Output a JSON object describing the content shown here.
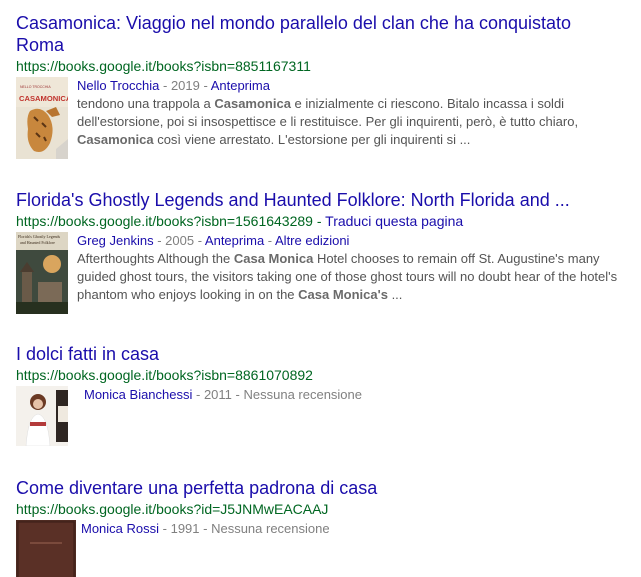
{
  "results": [
    {
      "title_line1": "Casamonica: Viaggio nel mondo parallelo del clan che ha conquistato",
      "title_line2": "Roma",
      "url": "https://books.google.it/books?isbn=8851167311",
      "author": "Nello Trocchia",
      "year": "2019",
      "preview": "Anteprima",
      "snippet_1": "tendono una trappola a ",
      "snippet_2": "Casamonica",
      "snippet_3": " e inizialmente ci riescono. Bitalo incassa i soldi dell'estorsione, poi si insospettisce e li restituisce. Per gli inquirenti, però, è tutto chiaro, ",
      "snippet_4": "Casamonica",
      "snippet_5": " così viene arrestato. L'estorsione per gli inquirenti si ...",
      "cover_text": "CASAMONICA"
    },
    {
      "title": "Florida's Ghostly Legends and Haunted Folklore: North Florida and ...",
      "url": "https://books.google.it/books?isbn=1561643289",
      "translate": "Traduci questa pagina",
      "author": "Greg Jenkins",
      "year": "2005",
      "preview": "Anteprima",
      "more": "Altre edizioni",
      "snippet_1": "Afterthoughts Although the ",
      "snippet_2": "Casa Monica",
      "snippet_3": " Hotel chooses to remain off St. Augustine's many guided ghost tours, the visitors taking one of those ghost tours will no doubt hear of the hotel's phantom who enjoys looking in on the ",
      "snippet_4": "Casa Monica's",
      "snippet_5": " ..."
    },
    {
      "title": "I dolci fatti in casa",
      "url": "https://books.google.it/books?isbn=8861070892",
      "author": "Monica Bianchessi",
      "year": "2011",
      "review": "Nessuna recensione"
    },
    {
      "title": "Come diventare una perfetta padrona di casa",
      "url": "https://books.google.it/books?id=J5JNMwEACAAJ",
      "author": "Monica Rossi",
      "year": "1991",
      "review": "Nessuna recensione"
    }
  ],
  "separators": {
    "dash": " - "
  },
  "colors": {
    "title": "#1a0dab",
    "url": "#006621",
    "snippet": "#545454"
  }
}
